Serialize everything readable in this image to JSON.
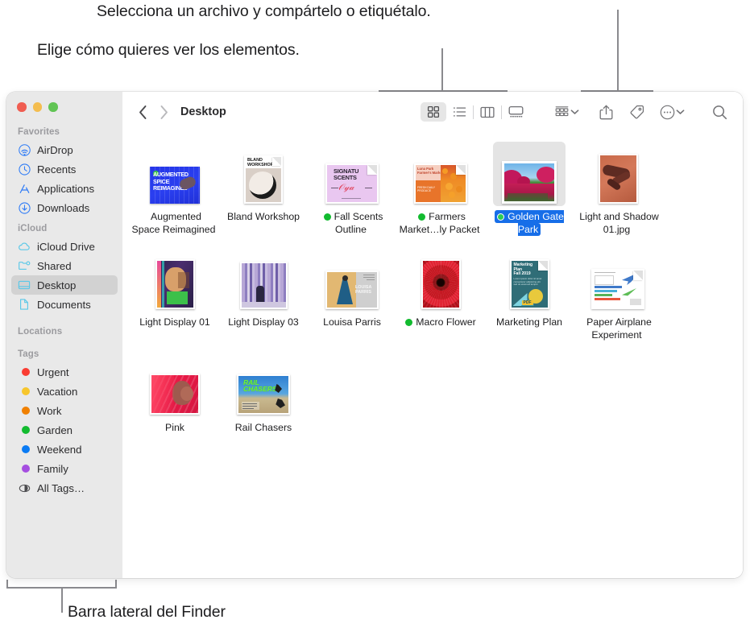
{
  "annotations": {
    "top_right": "Selecciona un archivo y compártelo o etiquétalo.",
    "top_left": "Elige cómo quieres ver los elementos.",
    "bottom_left": "Barra lateral del Finder"
  },
  "window": {
    "traffic_lights": {
      "close_color": "#f05d51",
      "minimize_color": "#f4bd4f",
      "maximize_color": "#61c454"
    }
  },
  "toolbar": {
    "back_label": "Back",
    "forward_label": "Forward",
    "path_title": "Desktop",
    "view_buttons": [
      {
        "name": "icon-view",
        "label": "Icon view",
        "active": true
      },
      {
        "name": "list-view",
        "label": "List view",
        "active": false
      },
      {
        "name": "column-view",
        "label": "Column view",
        "active": false
      },
      {
        "name": "gallery-view",
        "label": "Gallery view",
        "active": false
      }
    ],
    "group_button_label": "Group items",
    "share_button_label": "Share",
    "tag_button_label": "Tags",
    "more_button_label": "More",
    "search_button_label": "Search"
  },
  "sidebar": {
    "sections": [
      {
        "header": "Favorites",
        "items": [
          {
            "label": "AirDrop",
            "icon": "airdrop-icon",
            "color": "#2f7cf6",
            "selected": false
          },
          {
            "label": "Recents",
            "icon": "clock-icon",
            "color": "#2f7cf6",
            "selected": false
          },
          {
            "label": "Applications",
            "icon": "applications-icon",
            "color": "#2f7cf6",
            "selected": false
          },
          {
            "label": "Downloads",
            "icon": "download-icon",
            "color": "#2f7cf6",
            "selected": false
          }
        ]
      },
      {
        "header": "iCloud",
        "items": [
          {
            "label": "iCloud Drive",
            "icon": "cloud-icon",
            "color": "#5ac8e8",
            "selected": false
          },
          {
            "label": "Shared",
            "icon": "shared-folder-icon",
            "color": "#5ac8e8",
            "selected": false
          },
          {
            "label": "Desktop",
            "icon": "desktop-icon",
            "color": "#5ac8e8",
            "selected": true
          },
          {
            "label": "Documents",
            "icon": "document-icon",
            "color": "#5ac8e8",
            "selected": false
          }
        ]
      },
      {
        "header": "Locations",
        "items": []
      },
      {
        "header": "Tags",
        "items": [
          {
            "label": "Urgent",
            "icon": "tag-dot-icon",
            "color": "#fa3c32"
          },
          {
            "label": "Vacation",
            "icon": "tag-dot-icon",
            "color": "#f7c62c"
          },
          {
            "label": "Work",
            "icon": "tag-dot-icon",
            "color": "#f08000"
          },
          {
            "label": "Garden",
            "icon": "tag-dot-icon",
            "color": "#12bb2f"
          },
          {
            "label": "Weekend",
            "icon": "tag-dot-icon",
            "color": "#0a7bf4"
          },
          {
            "label": "Family",
            "icon": "tag-dot-icon",
            "color": "#a54ee0"
          },
          {
            "label": "All Tags…",
            "icon": "all-tags-icon",
            "color": "#4a4a4d"
          }
        ]
      }
    ]
  },
  "files": [
    {
      "name": "Augmented\nSpace Reimagined",
      "line1": "Augmented",
      "line2": "Space Reimagined",
      "tag": null,
      "selected": false,
      "art": "augmented"
    },
    {
      "name": "Bland Workshop",
      "line1": "Bland Workshop",
      "line2": "",
      "tag": null,
      "selected": false,
      "art": "bland"
    },
    {
      "name": "Fall Scents\nOutline",
      "line1": "Fall Scents",
      "line2": "Outline",
      "tag": "#12bb2f",
      "selected": false,
      "art": "fallscents"
    },
    {
      "name": "Farmers\nMarket…ly Packet",
      "line1": "Farmers",
      "line2": "Market…ly Packet",
      "tag": "#12bb2f",
      "selected": false,
      "art": "farmers"
    },
    {
      "name": "Golden Gate\nPark",
      "line1": "Golden Gate",
      "line2": "Park",
      "tag": "#12bb2f",
      "selected": true,
      "art": "goldengate"
    },
    {
      "name": "Light and Shadow\n01.jpg",
      "line1": "Light and Shadow",
      "line2": "01.jpg",
      "tag": null,
      "selected": false,
      "art": "lightshadow"
    },
    {
      "name": "Light Display 01",
      "line1": "Light Display 01",
      "line2": "",
      "tag": null,
      "selected": false,
      "art": "lightdisplay01"
    },
    {
      "name": "Light Display 03",
      "line1": "Light Display 03",
      "line2": "",
      "tag": null,
      "selected": false,
      "art": "lightdisplay03"
    },
    {
      "name": "Louisa Parris",
      "line1": "Louisa Parris",
      "line2": "",
      "tag": null,
      "selected": false,
      "art": "louisa"
    },
    {
      "name": "Macro Flower",
      "line1": "Macro Flower",
      "line2": "",
      "tag": "#12bb2f",
      "selected": false,
      "art": "macroflower"
    },
    {
      "name": "Marketing Plan",
      "line1": "Marketing Plan",
      "line2": "",
      "tag": null,
      "selected": false,
      "art": "marketing"
    },
    {
      "name": "Paper Airplane\nExperiment",
      "line1": "Paper Airplane",
      "line2": "Experiment",
      "tag": null,
      "selected": false,
      "art": "paperairplane"
    },
    {
      "name": "Pink",
      "line1": "Pink",
      "line2": "",
      "tag": null,
      "selected": false,
      "art": "pink"
    },
    {
      "name": "Rail Chasers",
      "line1": "Rail Chasers",
      "line2": "",
      "tag": null,
      "selected": false,
      "art": "railchasers"
    }
  ]
}
